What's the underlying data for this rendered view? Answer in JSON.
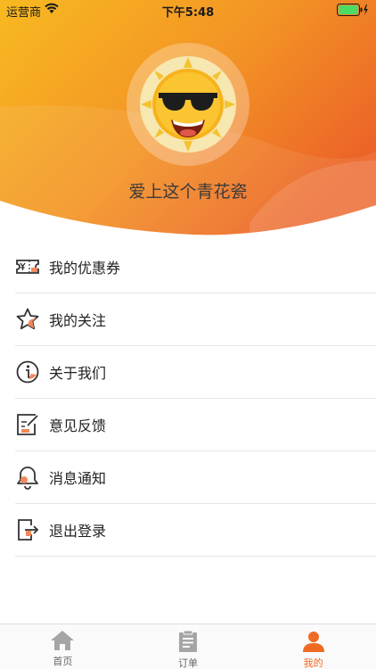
{
  "status_bar": {
    "carrier": "运营商",
    "time": "下午5:48"
  },
  "profile": {
    "nickname": "爱上这个青花瓷"
  },
  "menu": {
    "items": [
      {
        "label": "我的优惠券",
        "icon": "coupon-icon"
      },
      {
        "label": "我的关注",
        "icon": "star-icon"
      },
      {
        "label": "关于我们",
        "icon": "info-icon"
      },
      {
        "label": "意见反馈",
        "icon": "feedback-icon"
      },
      {
        "label": "消息通知",
        "icon": "bell-icon"
      },
      {
        "label": "退出登录",
        "icon": "logout-icon"
      }
    ]
  },
  "tabbar": {
    "tabs": [
      {
        "label": "首页",
        "icon": "home-icon"
      },
      {
        "label": "订单",
        "icon": "order-icon"
      },
      {
        "label": "我的",
        "icon": "user-icon",
        "active": true
      }
    ]
  },
  "colors": {
    "header_gradient_start": "#f7b520",
    "header_gradient_end": "#ee6a28",
    "accent": "#ef6b23",
    "icon_accent": "#f08a5d"
  }
}
